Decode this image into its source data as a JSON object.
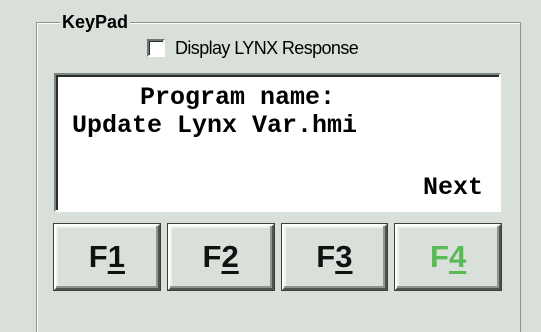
{
  "keypad": {
    "title": "KeyPad",
    "display_response": {
      "label": "Display LYNX Response",
      "checked": false
    },
    "screen": {
      "line1": "Program name:",
      "line2": "Update Lynx Var.hmi",
      "line3": "Next"
    },
    "function_keys": [
      {
        "prefix": "F",
        "mnemonic": "1",
        "label": "F1",
        "active": false
      },
      {
        "prefix": "F",
        "mnemonic": "2",
        "label": "F2",
        "active": false
      },
      {
        "prefix": "F",
        "mnemonic": "3",
        "label": "F3",
        "active": false
      },
      {
        "prefix": "F",
        "mnemonic": "4",
        "label": "F4",
        "active": true
      }
    ]
  },
  "colors": {
    "background": "#D9E0DA",
    "screen_background": "#FFFFFF",
    "active_key_text": "#58B956",
    "key_text": "#111111"
  }
}
